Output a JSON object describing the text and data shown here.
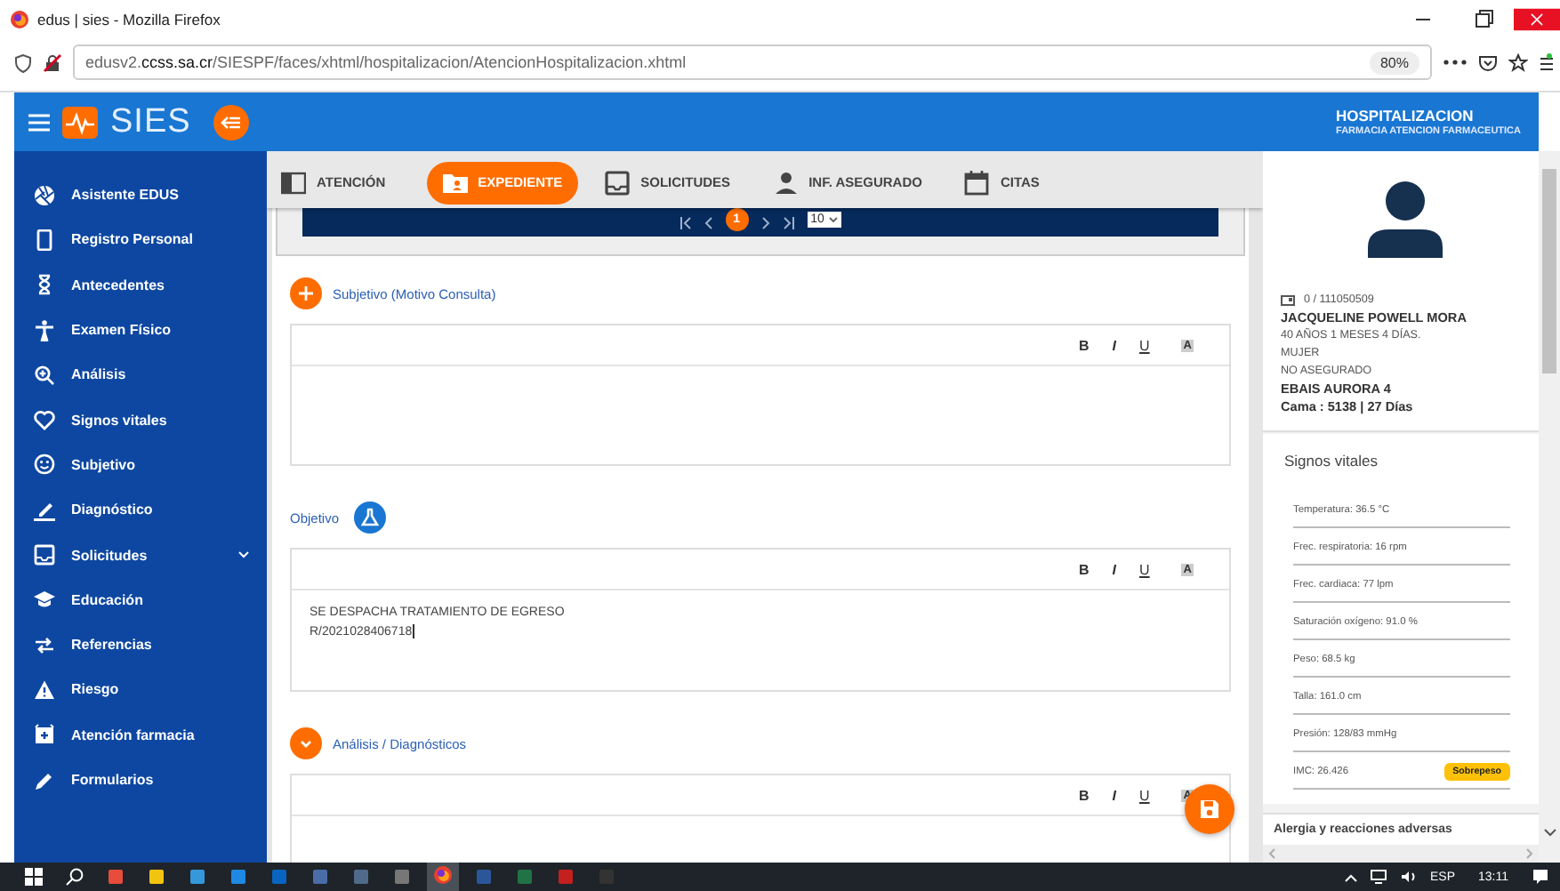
{
  "browser": {
    "title": "edus | sies - Mozilla Firefox",
    "url_prefix": "edusv2.",
    "url_domain": "ccss.sa.cr",
    "url_path": "/SIESPF/faces/xhtml/hospitalizacion/AtencionHospitalizacion.xhtml",
    "zoom": "80%"
  },
  "header": {
    "logo": "SIES",
    "module": "HOSPITALIZACION",
    "submodule": "FARMACIA ATENCION FARMACEUTICA"
  },
  "sidebar": {
    "items": [
      {
        "label": "Asistente EDUS",
        "kind": "link"
      },
      {
        "label": "Registro Personal",
        "kind": "link"
      },
      {
        "label": "Antecedentes",
        "kind": "link"
      },
      {
        "label": "Examen Físico",
        "kind": "link"
      },
      {
        "label": "Análisis",
        "kind": "link"
      },
      {
        "label": "Signos vitales",
        "kind": "link"
      },
      {
        "label": "Subjetivo",
        "kind": "link"
      },
      {
        "label": "Diagnóstico",
        "kind": "link"
      },
      {
        "label": "Solicitudes",
        "kind": "group"
      },
      {
        "label": "Educación",
        "kind": "link"
      },
      {
        "label": "Referencias",
        "kind": "link"
      },
      {
        "label": "Riesgo",
        "kind": "link"
      },
      {
        "label": "Atención farmacia",
        "kind": "link"
      },
      {
        "label": "Formularios",
        "kind": "link"
      }
    ]
  },
  "tabs": [
    {
      "label": "ATENCIÓN",
      "selected": false
    },
    {
      "label": "EXPEDIENTE",
      "selected": true
    },
    {
      "label": "SOLICITUDES",
      "selected": false
    },
    {
      "label": "INF. ASEGURADO",
      "selected": false
    },
    {
      "label": "CITAS",
      "selected": false
    }
  ],
  "pager": {
    "page": "1",
    "page_size": "10"
  },
  "sections": [
    {
      "title": "Subjetivo (Motivo Consulta)",
      "kind": "add",
      "toolbar": [
        "B",
        "I",
        "U",
        "A"
      ]
    },
    {
      "title": "Objetivo",
      "kind": "lab",
      "toolbar": [
        "B",
        "I",
        "U",
        "A"
      ],
      "lines": [
        "SE DESPACHA TRATAMIENTO DE EGRESO",
        "R/2021028406718"
      ]
    },
    {
      "title": "Análisis / Diagnósticos",
      "kind": "collapse",
      "toolbar": [
        "B",
        "I",
        "U",
        "A"
      ]
    }
  ],
  "patient": {
    "id": "0 / 111050509",
    "name": "JACQUELINE POWELL MORA",
    "age": "40 AÑOS 1 MESES 4 DÍAS.",
    "sex": "MUJER",
    "insurance": "NO ASEGURADO",
    "ebais": "EBAIS AURORA 4",
    "bed": "Cama : 5138 | 27 Días"
  },
  "vitals": {
    "title": "Signos vitales",
    "items": [
      {
        "text": "Temperatura: 36.5 °C"
      },
      {
        "text": "Frec. respiratoria: 16 rpm"
      },
      {
        "text": "Frec. cardiaca: 77 lpm"
      },
      {
        "text": "Saturación oxígeno: 91.0 %"
      },
      {
        "text": "Peso: 68.5 kg"
      },
      {
        "text": "Talla: 161.0 cm"
      },
      {
        "text": "Presión: 128/83 mmHg"
      },
      {
        "text": "IMC: 26.426",
        "badge": {
          "text": "Sobrepeso",
          "color": "#ffc107"
        }
      }
    ]
  },
  "allergies": {
    "title": "Alergia y reacciones adversas"
  },
  "taskbar": {
    "language": "ESP",
    "time": "13:11"
  }
}
